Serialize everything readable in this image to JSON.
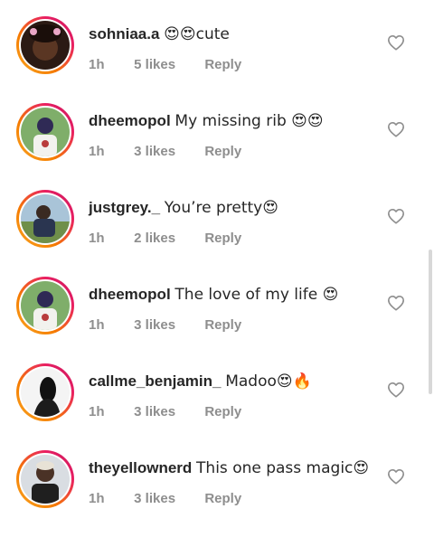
{
  "comments": [
    {
      "username": "sohniaa.a",
      "text": "😍😍cute",
      "time": "1h",
      "likes": "5 likes",
      "reply": "Reply",
      "icon": "heart-outline-icon"
    },
    {
      "username": "dheemopol",
      "text": "My missing rib 😍😍",
      "time": "1h",
      "likes": "3 likes",
      "reply": "Reply",
      "icon": "heart-outline-icon"
    },
    {
      "username": "justgrey._",
      "text": "You’re pretty😍",
      "time": "1h",
      "likes": "2 likes",
      "reply": "Reply",
      "icon": "heart-outline-icon"
    },
    {
      "username": "dheemopol",
      "text": "The love of my life 😍",
      "time": "1h",
      "likes": "3 likes",
      "reply": "Reply",
      "icon": "heart-outline-icon"
    },
    {
      "username": "callme_benjamin_",
      "text": "Madoo😍🔥",
      "time": "1h",
      "likes": "3 likes",
      "reply": "Reply",
      "icon": "heart-outline-icon"
    },
    {
      "username": "theyellownerd",
      "text": "This one pass magic😍",
      "time": "1h",
      "likes": "3 likes",
      "reply": "Reply",
      "icon": "heart-outline-icon"
    }
  ],
  "colors": {
    "text": "#262626",
    "meta": "#8e8e8e",
    "ring_start": "#f9a825",
    "ring_end": "#c2185b"
  }
}
